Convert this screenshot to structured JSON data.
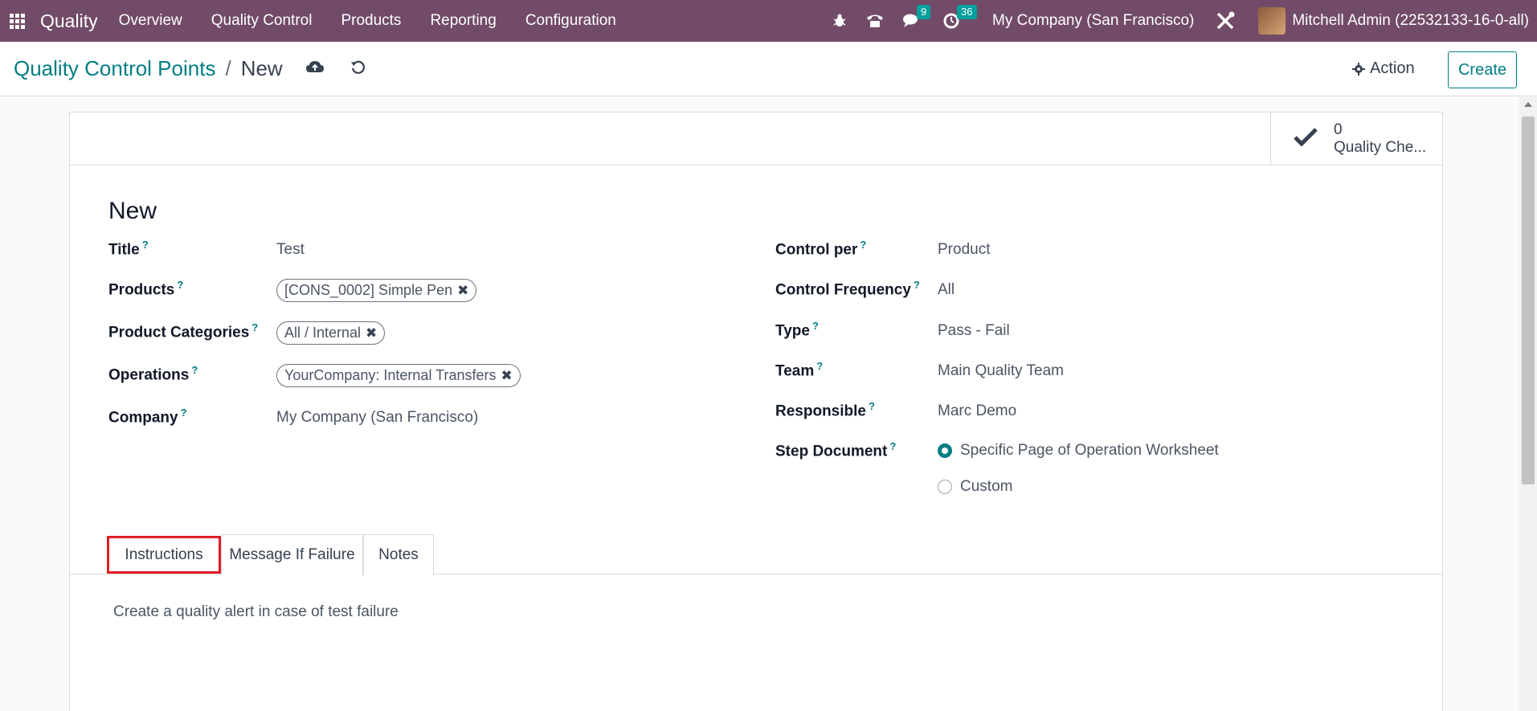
{
  "navbar": {
    "brand": "Quality",
    "menu": [
      "Overview",
      "Quality Control",
      "Products",
      "Reporting",
      "Configuration"
    ],
    "messages_count": "9",
    "activities_count": "36",
    "company": "My Company (San Francisco)",
    "user": "Mitchell Admin (22532133-16-0-all)"
  },
  "control_panel": {
    "breadcrumb_parent": "Quality Control Points",
    "breadcrumb_separator": "/",
    "breadcrumb_current": "New",
    "action_label": "Action",
    "create_label": "Create"
  },
  "smart_button": {
    "count": "0",
    "label": "Quality Che..."
  },
  "form": {
    "title": "New",
    "left": {
      "title_label": "Title",
      "title_value": "Test",
      "products_label": "Products",
      "products_tags": [
        "[CONS_0002] Simple Pen"
      ],
      "categories_label": "Product Categories",
      "categories_tags": [
        "All / Internal"
      ],
      "operations_label": "Operations",
      "operations_tags": [
        "YourCompany: Internal Transfers"
      ],
      "company_label": "Company",
      "company_value": "My Company (San Francisco)"
    },
    "right": {
      "control_per_label": "Control per",
      "control_per_value": "Product",
      "frequency_label": "Control Frequency",
      "frequency_value": "All",
      "type_label": "Type",
      "type_value": "Pass - Fail",
      "team_label": "Team",
      "team_value": "Main Quality Team",
      "responsible_label": "Responsible",
      "responsible_value": "Marc Demo",
      "step_document_label": "Step Document",
      "step_document_options": [
        "Specific Page of Operation Worksheet",
        "Custom"
      ],
      "step_document_selected": "Specific Page of Operation Worksheet"
    },
    "help_mark": "?"
  },
  "tabs": {
    "items": [
      "Instructions",
      "Message If Failure",
      "Notes"
    ],
    "active": "Instructions",
    "content": "Create a quality alert in case of test failure"
  },
  "colors": {
    "navbar": "#714b67",
    "accent": "#017e84",
    "highlight": "#e11d26"
  }
}
